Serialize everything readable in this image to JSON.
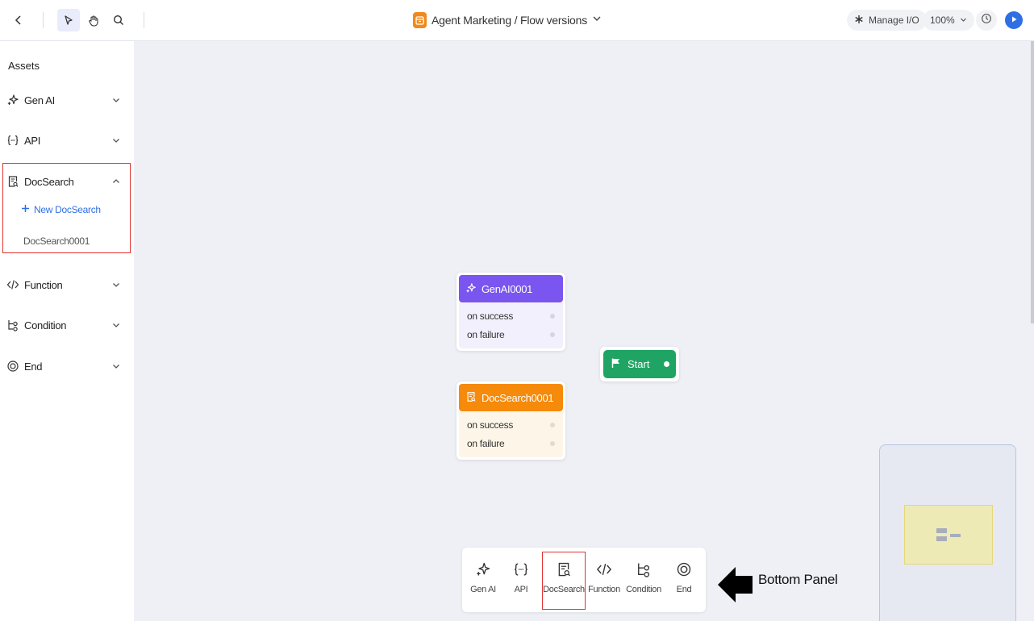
{
  "toolbar": {
    "title": "Agent Marketing / Flow versions",
    "manage_io": "Manage I/O",
    "zoom": "100%",
    "icons": [
      "back-icon",
      "pointer-icon",
      "hand-icon",
      "search-icon",
      "history-icon",
      "play-icon"
    ]
  },
  "sidebar": {
    "heading": "Assets",
    "items": [
      {
        "label": "Gen AI",
        "icon": "sparkle-icon",
        "expanded": false
      },
      {
        "label": "API",
        "icon": "braces-icon",
        "expanded": false
      },
      {
        "label": "DocSearch",
        "icon": "doc-search-icon",
        "expanded": true
      },
      {
        "label": "Function",
        "icon": "code-icon",
        "expanded": false
      },
      {
        "label": "Condition",
        "icon": "branch-icon",
        "expanded": false
      },
      {
        "label": "End",
        "icon": "end-icon",
        "expanded": false
      }
    ],
    "docsearch": {
      "new_label": "New DocSearch",
      "children": [
        "DocSearch0001"
      ]
    }
  },
  "canvas": {
    "nodes": [
      {
        "title": "GenAI0001",
        "color": "#7a55f0",
        "body_color": "#f2f0fd",
        "outputs": [
          "on success",
          "on failure"
        ]
      },
      {
        "title": "DocSearch0001",
        "color": "#f58a0b",
        "body_color": "#fdf6e8",
        "outputs": [
          "on success",
          "on failure"
        ]
      }
    ],
    "start": {
      "label": "Start",
      "color": "#1fa463"
    }
  },
  "bottom_panel": {
    "items": [
      "Gen AI",
      "API",
      "DocSearch",
      "Function",
      "Condition",
      "End"
    ],
    "highlighted": "DocSearch",
    "annotation": "Bottom Panel"
  },
  "colors": {
    "accent": "#2f6fe6",
    "highlight_border": "#e03434"
  }
}
